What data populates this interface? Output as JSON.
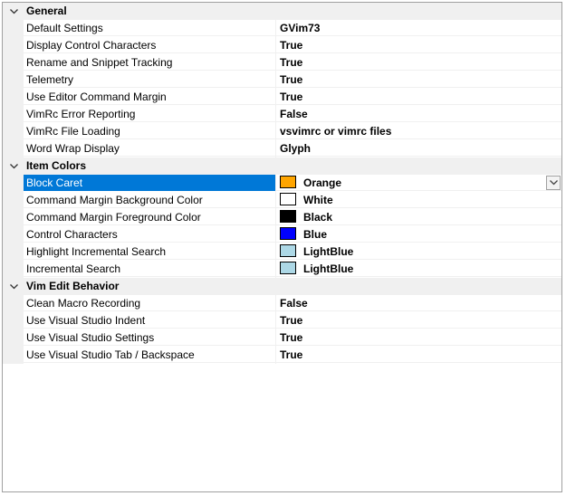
{
  "categories": [
    {
      "label": "General",
      "items": [
        {
          "name": "Default Settings",
          "value": "GVim73"
        },
        {
          "name": "Display Control Characters",
          "value": "True"
        },
        {
          "name": "Rename and Snippet Tracking",
          "value": "True"
        },
        {
          "name": "Telemetry",
          "value": "True"
        },
        {
          "name": "Use Editor Command Margin",
          "value": "True"
        },
        {
          "name": "VimRc Error Reporting",
          "value": "False"
        },
        {
          "name": "VimRc File Loading",
          "value": "vsvimrc or vimrc files"
        },
        {
          "name": "Word Wrap Display",
          "value": "Glyph"
        }
      ]
    },
    {
      "label": "Item Colors",
      "items": [
        {
          "name": "Block Caret",
          "value": "Orange",
          "color": "#ffa500",
          "selected": true
        },
        {
          "name": "Command Margin Background Color",
          "value": "White",
          "color": "#ffffff"
        },
        {
          "name": "Command Margin Foreground Color",
          "value": "Black",
          "color": "#000000"
        },
        {
          "name": "Control Characters",
          "value": "Blue",
          "color": "#0000ff"
        },
        {
          "name": "Highlight Incremental Search",
          "value": "LightBlue",
          "color": "#add8e6"
        },
        {
          "name": "Incremental Search",
          "value": "LightBlue",
          "color": "#add8e6"
        }
      ]
    },
    {
      "label": "Vim Edit Behavior",
      "items": [
        {
          "name": "Clean Macro Recording",
          "value": "False"
        },
        {
          "name": "Use Visual Studio Indent",
          "value": "True"
        },
        {
          "name": "Use Visual Studio Settings",
          "value": "True"
        },
        {
          "name": "Use Visual Studio Tab / Backspace",
          "value": "True"
        }
      ]
    }
  ],
  "icons": {
    "category_toggle": "chevron-down-icon",
    "value_dropdown": "chevron-down-icon"
  },
  "colors": {
    "selection": "#0078d7",
    "category_background": "#f0f0f0",
    "grid_line": "#f0f0f0"
  }
}
